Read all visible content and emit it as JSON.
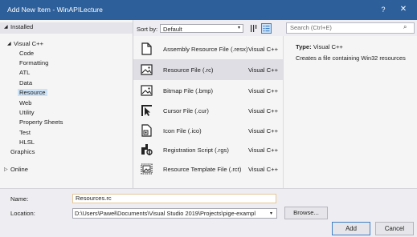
{
  "window": {
    "title": "Add New Item - WinAPILecture",
    "help_glyph": "?",
    "close_glyph": "✕"
  },
  "tree": {
    "installed": "Installed",
    "installed_arrow": "◢",
    "visual_cpp": "Visual C++",
    "visual_cpp_arrow": "◢",
    "children": [
      "Code",
      "Formatting",
      "ATL",
      "Data",
      "Resource",
      "Web",
      "Utility",
      "Property Sheets",
      "Test",
      "HLSL"
    ],
    "selected_child": "Resource",
    "graphics": "Graphics",
    "online": "Online",
    "online_arrow": "▷"
  },
  "toolbar": {
    "sort_label": "Sort by:",
    "sort_value": "Default",
    "chevron": "▾",
    "search_placeholder": "Search (Ctrl+E)",
    "search_icon": "⌕"
  },
  "items": [
    {
      "name": "Assembly Resource File (.resx)",
      "lang": "Visual C++",
      "icon": "document-icon"
    },
    {
      "name": "Resource File (.rc)",
      "lang": "Visual C++",
      "icon": "image-icon"
    },
    {
      "name": "Bitmap File (.bmp)",
      "lang": "Visual C++",
      "icon": "image-icon"
    },
    {
      "name": "Cursor File (.cur)",
      "lang": "Visual C++",
      "icon": "cursor-icon"
    },
    {
      "name": "Icon File (.ico)",
      "lang": "Visual C++",
      "icon": "icon-file-icon"
    },
    {
      "name": "Registration Script (.rgs)",
      "lang": "Visual C++",
      "icon": "registration-icon"
    },
    {
      "name": "Resource Template File (.rct)",
      "lang": "Visual C++",
      "icon": "template-icon"
    }
  ],
  "selected_item": "Resource File (.rc)",
  "detail": {
    "type_label": "Type:",
    "type_value": "Visual C++",
    "description": "Creates a file containing Win32 resources"
  },
  "form": {
    "name_label": "Name:",
    "name_value": "Resources.rc",
    "location_label": "Location:",
    "location_value": "D:\\Users\\Paweł\\Documents\\Visual Studio 2019\\Projects\\pige-exampl",
    "browse_label": "Browse...",
    "add_label": "Add",
    "cancel_label": "Cancel"
  },
  "colors": {
    "titlebar": "#2d5f9a",
    "selection": "#cce2f7",
    "accent": "#3e7fc4"
  }
}
